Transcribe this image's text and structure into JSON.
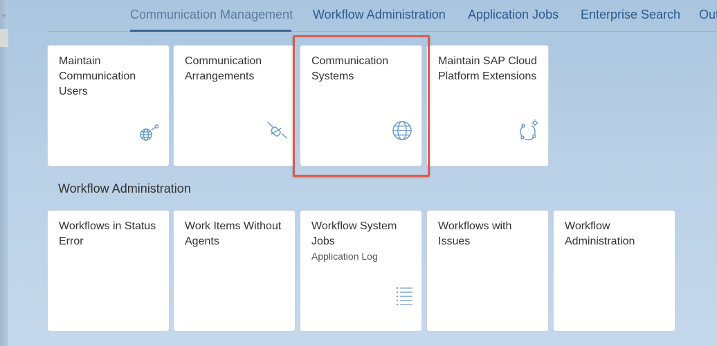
{
  "tabs": [
    {
      "label": "Communication Management",
      "active": true
    },
    {
      "label": "Workflow Administration"
    },
    {
      "label": "Application Jobs"
    },
    {
      "label": "Enterprise Search"
    },
    {
      "label": "Out"
    }
  ],
  "communication_tiles": [
    {
      "title": "Maintain Communication Users",
      "icon": "globe-user-icon"
    },
    {
      "title": "Communication Arrangements",
      "icon": "disconnected-icon"
    },
    {
      "title": "Communication Systems",
      "icon": "globe-icon",
      "highlighted": true
    },
    {
      "title": "Maintain SAP Cloud Platform Extensions",
      "icon": "network-settings-icon"
    }
  ],
  "workflow_section": {
    "title": "Workflow Administration",
    "tiles": [
      {
        "title": "Workflows in Status Error"
      },
      {
        "title": "Work Items Without Agents"
      },
      {
        "title": "Workflow System Jobs",
        "subtitle": "Application Log",
        "icon": "list-icon"
      },
      {
        "title": "Workflows with Issues"
      },
      {
        "title": "Workflow Administration"
      }
    ]
  },
  "colors": {
    "tab_text": "#2c5a8a",
    "icon": "#6a9ac8",
    "highlight_border": "#e0584b"
  }
}
